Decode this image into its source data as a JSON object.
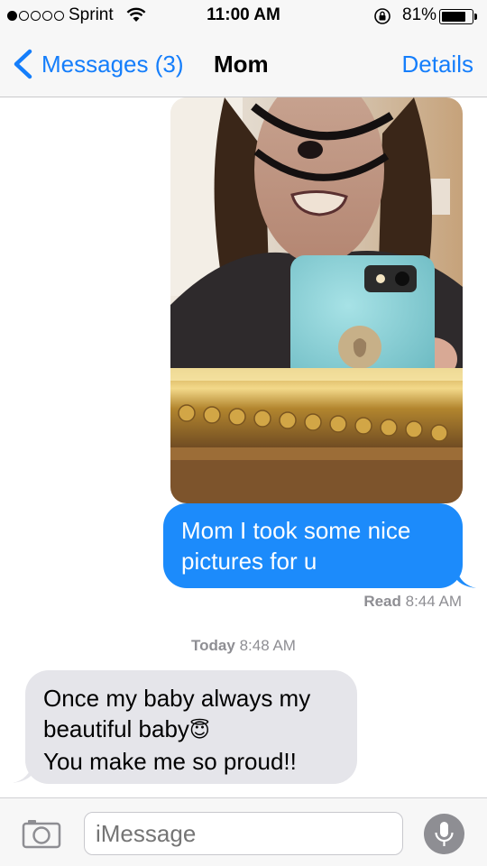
{
  "status_bar": {
    "carrier": "Sprint",
    "time": "11:00 AM",
    "battery_percent": "81%",
    "battery_level": 0.81,
    "signal_bars": 1,
    "icons": [
      "signal-dots-icon",
      "wifi-icon",
      "rotation-lock-icon",
      "battery-icon"
    ]
  },
  "nav": {
    "back_label": "Messages (3)",
    "title": "Mom",
    "details_label": "Details"
  },
  "conversation": {
    "photo": {
      "type": "image",
      "description_icon": "photo-attachment"
    },
    "sent_message": {
      "text": "Mom I took some nice pictures for u",
      "bubble_color": "#1c8bfb"
    },
    "read_receipt": {
      "label": "Read",
      "time": "8:44 AM"
    },
    "timestamp": {
      "day": "Today",
      "time": "8:48 AM"
    },
    "received_message": {
      "line1": "Once my baby always my",
      "line2": "beautiful baby",
      "line3": "You make me so proud!!",
      "emoji": "😇",
      "bubble_color": "#e5e5ea"
    }
  },
  "input_bar": {
    "placeholder": "iMessage",
    "icons": [
      "camera-icon",
      "microphone-icon"
    ]
  },
  "colors": {
    "accent": "#157efb",
    "sent_bubble": "#1c8bfb",
    "received_bubble": "#e5e5ea"
  }
}
